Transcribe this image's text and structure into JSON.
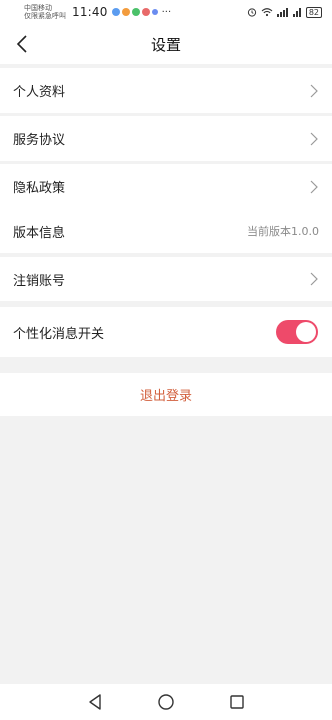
{
  "status_bar": {
    "carrier_line1": "中国移动",
    "carrier_line2": "仅限紧急呼叫",
    "time": "11:40",
    "more": "···",
    "battery": "82",
    "icon_colors": [
      "#5b9cf0",
      "#f39c3d",
      "#4bc16a",
      "#e86a6a",
      "#6a8cf0"
    ]
  },
  "header": {
    "title": "设置",
    "back_icon": "chevron-left-icon"
  },
  "settings": {
    "profile_label": "个人资料",
    "service_agreement_label": "服务协议",
    "privacy_policy_label": "隐私政策",
    "version_label": "版本信息",
    "version_value": "当前版本1.0.0",
    "cancel_account_label": "注销账号",
    "personalized_msg_label": "个性化消息开关",
    "personalized_msg_enabled": true
  },
  "logout": {
    "label": "退出登录"
  },
  "colors": {
    "accent": "#ee4a6a",
    "logout_text": "#d2603e",
    "background": "#f2f2f2"
  },
  "navbar": {
    "back_icon": "triangle-back-icon",
    "home_icon": "circle-home-icon",
    "recents_icon": "square-recents-icon"
  }
}
